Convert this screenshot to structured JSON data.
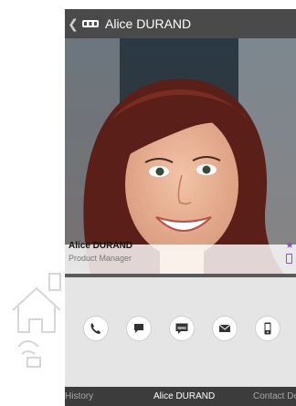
{
  "header": {
    "title": "Alice DURAND"
  },
  "contact": {
    "name": "Alice DURAND",
    "role": "Product Manager"
  },
  "icons": {
    "back": "back-chevron-icon",
    "app": "app-logo-icon",
    "favorite": "star-icon",
    "mobile": "mobile-phone-icon"
  },
  "actions": [
    {
      "name": "call",
      "icon": "phone-icon"
    },
    {
      "name": "chat",
      "icon": "chat-bubble-icon"
    },
    {
      "name": "sms",
      "icon": "sms-icon",
      "label": "SMS"
    },
    {
      "name": "email",
      "icon": "envelope-icon"
    },
    {
      "name": "mobile",
      "icon": "mobile-device-icon"
    }
  ],
  "tabs": {
    "history": "History",
    "current": "Alice DURAND",
    "details": "Contact De"
  },
  "colors": {
    "accent": "#8e4fc7",
    "topbar": "#4a4a4a",
    "bottombar": "#3c3c3c"
  }
}
